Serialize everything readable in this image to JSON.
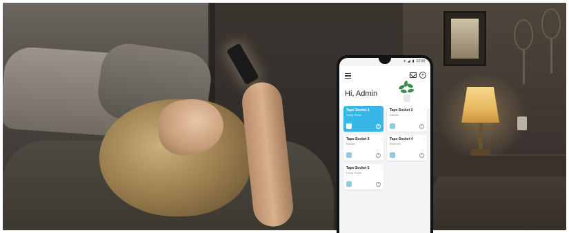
{
  "app": {
    "greeting": "Hi, Admin",
    "status_time": "12:30",
    "accent_color": "#37b7e8"
  },
  "header": {
    "menu_icon": "menu-icon",
    "mail_icon": "mail-icon",
    "add_icon": "add-icon"
  },
  "devices": [
    {
      "name": "Tapo Socket 1",
      "room": "Living Room",
      "active": true,
      "icon": "lamp-icon"
    },
    {
      "name": "Tapo Socket 2",
      "room": "Kitchen",
      "active": false,
      "icon": "appliance-icon"
    },
    {
      "name": "Tapo Socket 3",
      "room": "Kitchen",
      "active": false,
      "icon": "appliance-icon"
    },
    {
      "name": "Tapo Socket 4",
      "room": "Bedroom",
      "active": false,
      "icon": "appliance-icon"
    },
    {
      "name": "Tapo Socket 5",
      "room": "Living Room",
      "active": false,
      "icon": "appliance-icon"
    }
  ]
}
